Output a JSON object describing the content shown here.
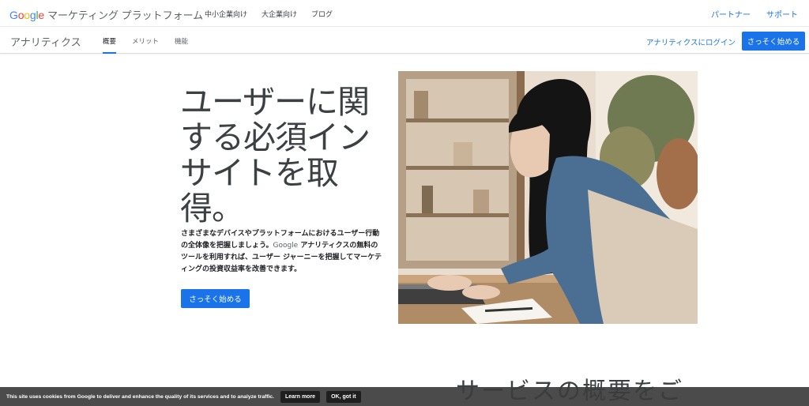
{
  "header": {
    "brand_letters": [
      "G",
      "o",
      "o",
      "g",
      "l",
      "e"
    ],
    "product": "マーケティング プラットフォーム",
    "nav": [
      "中小企業向け",
      "大企業向け",
      "ブログ"
    ],
    "right_links": [
      "パートナー",
      "サポート"
    ]
  },
  "subheader": {
    "product_name": "アナリティクス",
    "tabs": [
      "概要",
      "メリット",
      "機能"
    ],
    "active_tab": "概要",
    "login_link": "アナリティクスにログイン",
    "start_button": "さっそく始める"
  },
  "hero": {
    "headline": "ユーザーに関する必須インサイトを取得。",
    "description_part1": "さまざまなデバイスやプラットフォームにおけるユーザー行動の全体像を把握しましょう。",
    "description_google": "Google",
    "description_part2": " アナリティクスの無料のツールを利用すれば、ユーザー ジャーニーを把握してマーケティングの投資収益率を改善できます。",
    "start_button": "さっそく始める"
  },
  "section": {
    "heading": "サービスの概要をご"
  },
  "cookie_bar": {
    "message": "This site uses cookies from Google to deliver and enhance the quality of its services and to analyze traffic.",
    "learn_more": "Learn more",
    "ok": "OK, got it"
  },
  "colors": {
    "accent": "#1a73e8",
    "cookie_bg": "#3c3c3c"
  }
}
